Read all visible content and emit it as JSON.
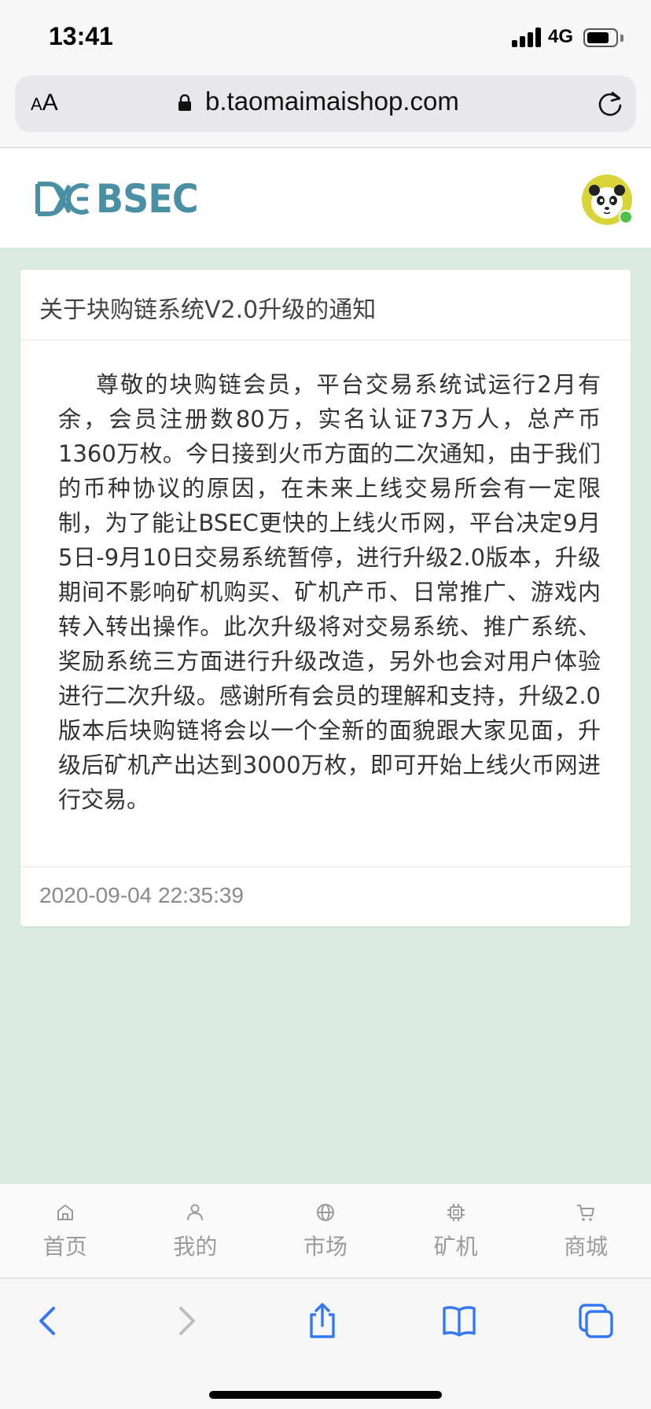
{
  "status_bar": {
    "time": "13:41",
    "network": "4G",
    "battery_level": 0.75
  },
  "browser": {
    "aa_label_small": "A",
    "aa_label_large": "A",
    "url": "b.taomaimaishop.com"
  },
  "site": {
    "logo_text": "BSEC",
    "brand_color": "#4a8fa3"
  },
  "notice": {
    "title": "关于块购链系统V2.0升级的通知",
    "body": "尊敬的块购链会员，平台交易系统试运行2月有余，会员注册数80万，实名认证73万人，总产币1360万枚。今日接到火币方面的二次通知，由于我们的币种协议的原因，在未来上线交易所会有一定限制，为了能让BSEC更快的上线火币网，平台决定9月5日-9月10日交易系统暂停，进行升级2.0版本，升级期间不影响矿机购买、矿机产币、日常推广、游戏内转入转出操作。此次升级将对交易系统、推广系统、奖励系统三方面进行升级改造，另外也会对用户体验进行二次升级。感谢所有会员的理解和支持，升级2.0版本后块购链将会以一个全新的面貌跟大家见面，升级后矿机产出达到3000万枚，即可开始上线火币网进行交易。",
    "date": "2020-09-04 22:35:39"
  },
  "app_nav": {
    "items": [
      {
        "label": "首页",
        "icon": "home-icon"
      },
      {
        "label": "我的",
        "icon": "user-icon"
      },
      {
        "label": "市场",
        "icon": "globe-icon"
      },
      {
        "label": "矿机",
        "icon": "chip-icon"
      },
      {
        "label": "商城",
        "icon": "cart-icon"
      }
    ]
  },
  "colors": {
    "content_background": "#d9ebe3",
    "browser_accent": "#3478f6",
    "online": "#4fc14a"
  }
}
